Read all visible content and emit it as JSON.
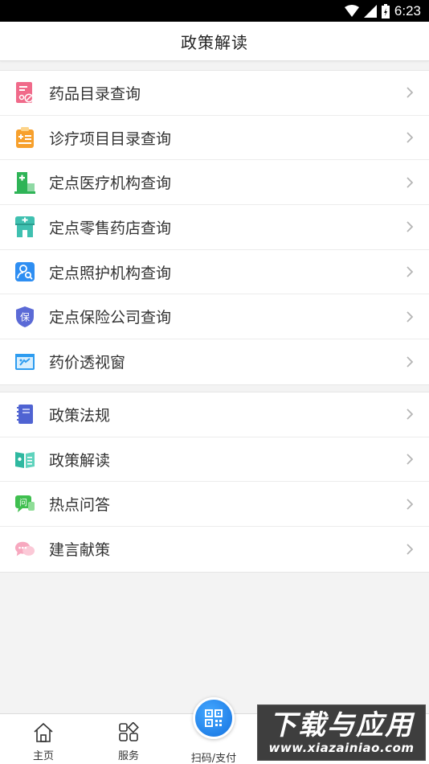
{
  "status": {
    "time": "6:23"
  },
  "header": {
    "title": "政策解读"
  },
  "query_list": [
    {
      "label": "药品目录查询",
      "icon": "drug-catalog-icon"
    },
    {
      "label": "诊疗项目目录查询",
      "icon": "clipboard-medical-icon"
    },
    {
      "label": "定点医疗机构查询",
      "icon": "hospital-icon"
    },
    {
      "label": "定点零售药店查询",
      "icon": "pharmacy-icon"
    },
    {
      "label": "定点照护机构查询",
      "icon": "person-search-icon"
    },
    {
      "label": "定点保险公司查询",
      "icon": "insurance-shield-icon"
    },
    {
      "label": "药价透视窗",
      "icon": "price-window-icon"
    }
  ],
  "policy_list": [
    {
      "label": "政策法规",
      "icon": "notebook-icon"
    },
    {
      "label": "政策解读",
      "icon": "book-icon"
    },
    {
      "label": "热点问答",
      "icon": "qa-chat-icon"
    },
    {
      "label": "建言献策",
      "icon": "suggestion-chat-icon"
    }
  ],
  "bottom_nav": {
    "home": "主页",
    "service": "服务",
    "scan": "扫码/支付"
  },
  "watermark": {
    "main": "下载与应用",
    "url": "www.xiazainiao.com"
  },
  "colors": {
    "accent_blue": "#1f86f0",
    "chevron": "#b5b5b5",
    "background": "#f3f3f3"
  }
}
